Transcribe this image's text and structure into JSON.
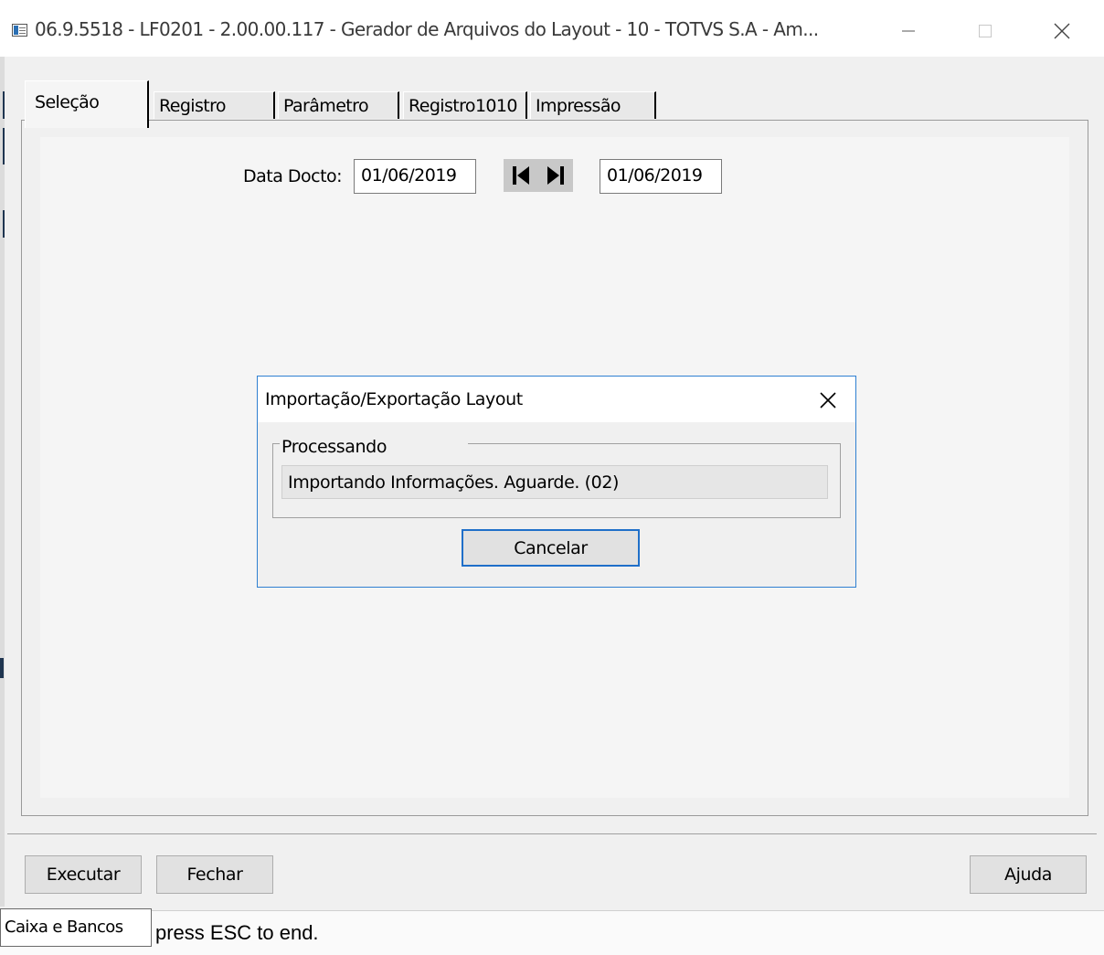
{
  "window": {
    "title": "06.9.5518 - LF0201 - 2.00.00.117 - Gerador de Arquivos do Layout - 10 - TOTVS S.A - Am..."
  },
  "tabs": [
    {
      "label": "Seleção",
      "selected": true
    },
    {
      "label": "Registro",
      "selected": false
    },
    {
      "label": "Parâmetro",
      "selected": false
    },
    {
      "label": "Registro1010",
      "selected": false
    },
    {
      "label": "Impressão",
      "selected": false
    }
  ],
  "selection": {
    "data_docto_label": "Data Docto:",
    "date_from": "01/06/2019",
    "date_to": "01/06/2019"
  },
  "dialog": {
    "title": "Importação/Exportação Layout",
    "group_label": "Processando",
    "progress_text": "Importando Informações. Aguarde.  (02)",
    "cancel_label": "Cancelar"
  },
  "buttons": {
    "executar": "Executar",
    "fechar": "Fechar",
    "ajuda": "Ajuda"
  },
  "status": {
    "tooltip": "Caixa e Bancos",
    "text": "press ESC to end."
  },
  "icons": {
    "app": "app-icon",
    "minimize": "minimize-icon",
    "maximize": "maximize-icon",
    "close": "close-icon",
    "first": "first-record-icon",
    "last": "last-record-icon"
  },
  "colors": {
    "dialog_border": "#2f80d1",
    "focus_border": "#1f6fc9",
    "background": "#f0f0f0"
  }
}
